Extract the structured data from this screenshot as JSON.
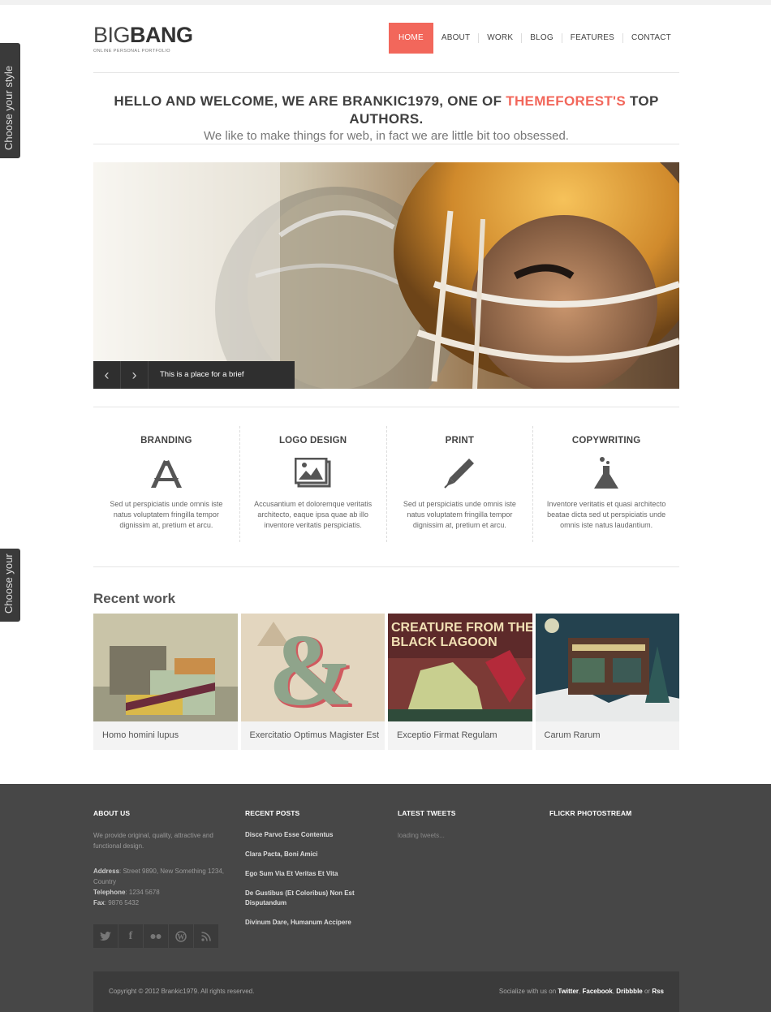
{
  "side_tabs": [
    "Choose your style",
    "Choose your"
  ],
  "logo": {
    "thin": "BIG",
    "bold": "BANG",
    "tagline": "ONLINE PERSONAL PORTFOLIO"
  },
  "nav": [
    "HOME",
    "ABOUT",
    "WORK",
    "BLOG",
    "FEATURES",
    "CONTACT"
  ],
  "welcome": {
    "headline_start": "HELLO AND WELCOME, WE ARE BRANKIC1979, ONE OF ",
    "headline_accent": "THEMEFOREST'S",
    "headline_end": " TOP AUTHORS.",
    "subline": "We like to make things for web, in fact we are little bit too obsessed."
  },
  "slider": {
    "caption": "This is a place for a brief description.",
    "prev_icon": "chevron-left-icon",
    "next_icon": "chevron-right-icon"
  },
  "services": [
    {
      "title": "BRANDING",
      "icon": "branding-tools-icon",
      "text": "Sed ut perspiciatis unde omnis iste natus voluptatem fringilla tempor dignissim at, pretium et arcu."
    },
    {
      "title": "LOGO DESIGN",
      "icon": "image-frame-icon",
      "text": "Accusantium et doloremque veritatis architecto, eaque ipsa quae ab illo inventore veritatis perspiciatis."
    },
    {
      "title": "PRINT",
      "icon": "pen-icon",
      "text": "Sed ut perspiciatis unde omnis iste natus voluptatem fringilla tempor dignissim at, pretium et arcu."
    },
    {
      "title": "COPYWRITING",
      "icon": "flask-icon",
      "text": "Inventore veritatis et quasi architecto beatae dicta sed ut perspiciatis unde omnis iste natus laudantium."
    }
  ],
  "recent_work": {
    "title": "Recent work",
    "items": [
      {
        "title": "Homo homini lupus"
      },
      {
        "title": "Exercitatio Optimus Magister Est"
      },
      {
        "title": "Exceptio Firmat Regulam",
        "poster_text": "CREATURE FROM THE BLACK LAGOON"
      },
      {
        "title": "Carum Rarum"
      }
    ]
  },
  "footer": {
    "about": {
      "title": "ABOUT US",
      "text": "We provide original, quality, attractive and functional design.",
      "address_label": "Address",
      "address": ": Street 9890, New Something 1234, Country",
      "telephone_label": "Telephone",
      "telephone": ": 1234 5678",
      "fax_label": "Fax",
      "fax": ": 9876 5432"
    },
    "recent_posts": {
      "title": "RECENT POSTS",
      "posts": [
        "Disce Parvo Esse Contentus",
        "Clara Pacta, Boni Amici",
        "Ego Sum Via Et Veritas Et Vita",
        "De Gustibus (Et Coloribus) Non Est Disputandum",
        "Divinum Dare, Humanum Accipere"
      ]
    },
    "tweets": {
      "title": "LATEST TWEETS",
      "text": "loading tweets..."
    },
    "flickr": {
      "title": "FLICKR PHOTOSTREAM"
    },
    "social_icons": [
      "twitter-icon",
      "facebook-icon",
      "flickr-icon",
      "wordpress-icon",
      "rss-icon"
    ],
    "copyright": "Copyright © 2012 Brankic1979. All rights reserved.",
    "socialize_prefix": "Socialize with us on ",
    "socialize_links": [
      "Twitter",
      "Facebook",
      "Dribbble",
      "Rss"
    ]
  },
  "colors": {
    "accent": "#f2675b",
    "footer_bg": "#474747",
    "footer_bar": "#3b3b3b"
  }
}
